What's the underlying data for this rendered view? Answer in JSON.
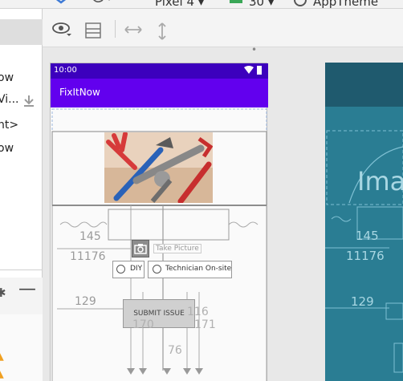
{
  "toolbar": {
    "device": "Pixel 4",
    "api": "30",
    "theme": "AppTheme"
  },
  "palette": {
    "items": [
      "ow",
      "Vi...",
      "nt>",
      "ow"
    ]
  },
  "phone": {
    "time": "10:00",
    "app_title": "FixItNow",
    "take_picture": "Take Picture",
    "diy": "DIY",
    "technician": "Technician On-site",
    "submit": "SUBMIT ISSUE",
    "dims": {
      "d145": "145",
      "d11176": "11176",
      "d129": "129",
      "d170": "170",
      "d116": "116",
      "d171": "171",
      "d76": "76"
    }
  },
  "blueprint": {
    "image_label": "Ima",
    "d145": "145",
    "d11176": "11176",
    "d129": "129"
  },
  "colors": {
    "status_bar": "#3c00bd",
    "app_bar": "#6200ee",
    "blueprint_bg": "#1f5a6e",
    "blueprint_inner": "#2a7d93"
  }
}
